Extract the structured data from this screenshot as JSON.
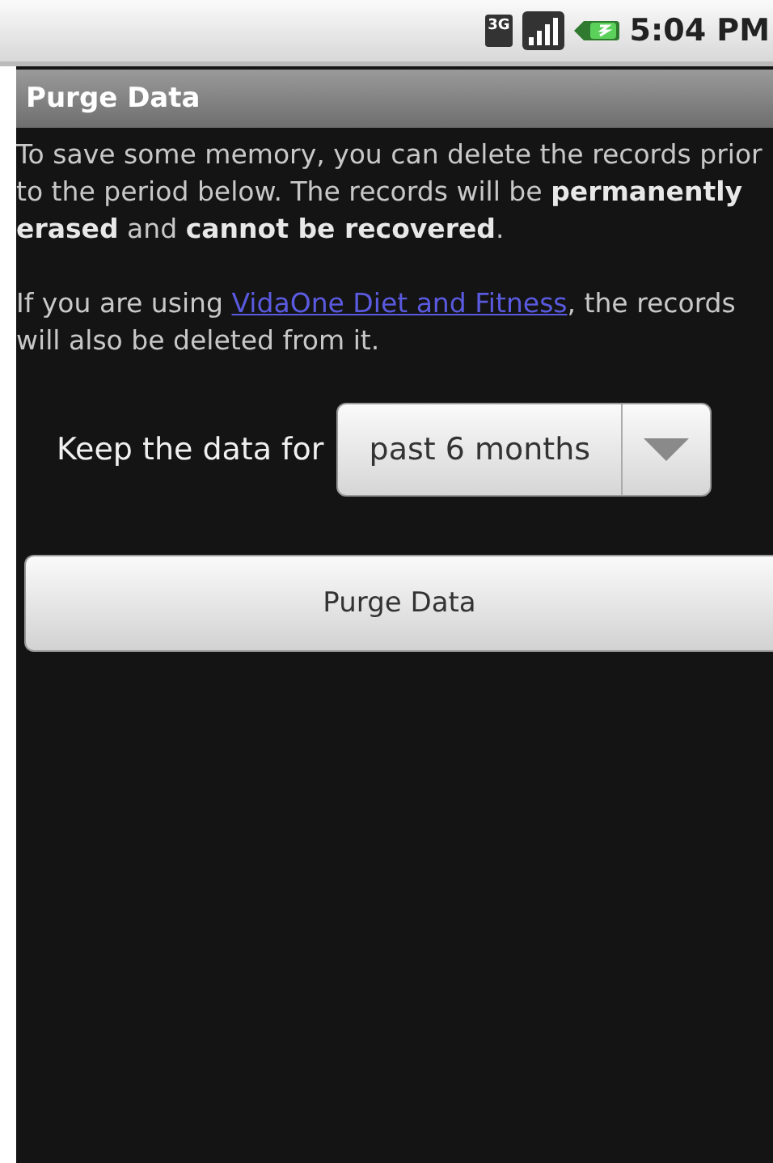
{
  "status_bar": {
    "time": "5:04 PM",
    "network": "3G"
  },
  "title_bar": {
    "title": "Purge Data"
  },
  "message": "To save some memory, you can delete the records prior to the period below. The records will be **permanently erased** and **cannot be recovered**.",
  "note": {
    "before": "If you are using ",
    "link": "VidaOne Diet and Fitness",
    "after": ", the records will also be deleted from it."
  },
  "keep_row": {
    "label": "Keep the data for",
    "dropdown": {
      "value": "past 6 months"
    }
  },
  "buttons": [
    {
      "label": "Purge Data"
    }
  ]
}
